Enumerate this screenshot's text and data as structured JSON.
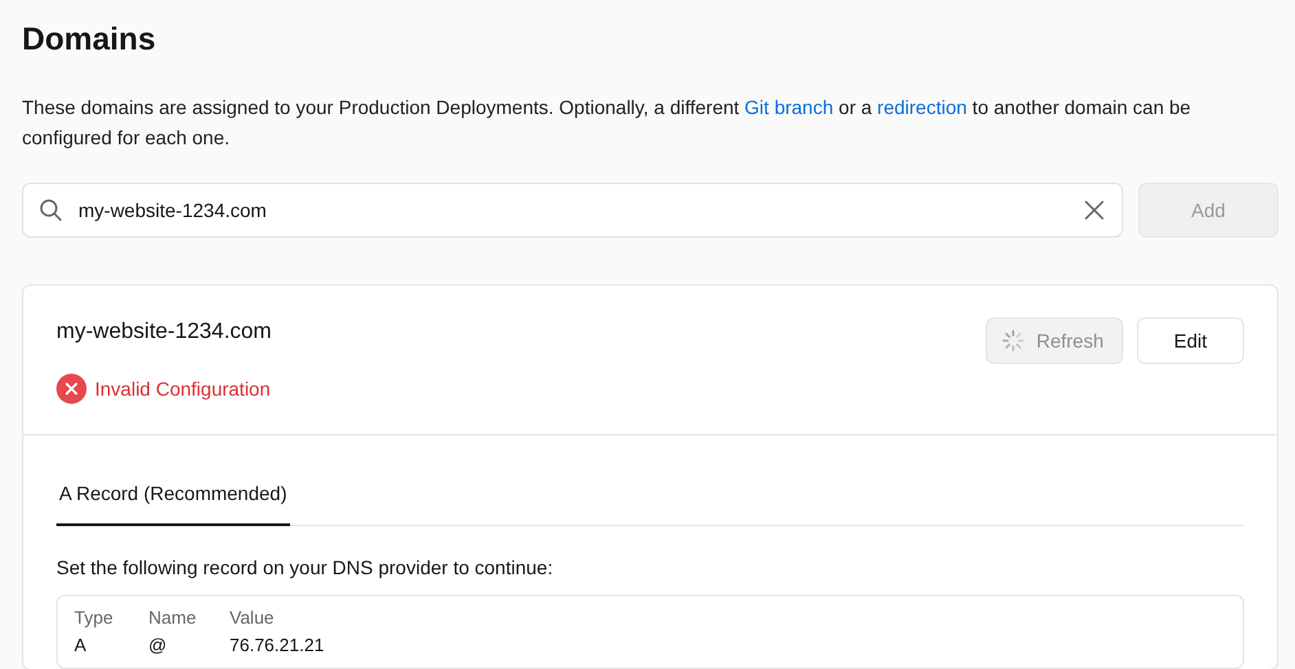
{
  "page": {
    "title": "Domains",
    "description": [
      {
        "kind": "text",
        "text": "These domains are assigned to your Production Deployments. Optionally, a different "
      },
      {
        "kind": "link",
        "text": "Git branch"
      },
      {
        "kind": "text",
        "text": " or a "
      },
      {
        "kind": "link",
        "text": "redirection"
      },
      {
        "kind": "text",
        "text": " to another domain can be configured for each one."
      }
    ]
  },
  "search": {
    "value": "my-website-1234.com"
  },
  "add_button": {
    "label": "Add",
    "disabled": true
  },
  "domain_card": {
    "domain": "my-website-1234.com",
    "status": {
      "kind": "error",
      "label": "Invalid Configuration"
    },
    "refresh_button": {
      "label": "Refresh",
      "loading": true
    },
    "edit_button": {
      "label": "Edit"
    },
    "tabs": [
      {
        "label": "A Record (Recommended)",
        "selected": true
      }
    ],
    "instruction": "Set the following record on your DNS provider to continue:",
    "table": {
      "columns": [
        "Type",
        "Name",
        "Value"
      ],
      "rows": [
        [
          "A",
          "@",
          "76.76.21.21"
        ]
      ]
    }
  }
}
